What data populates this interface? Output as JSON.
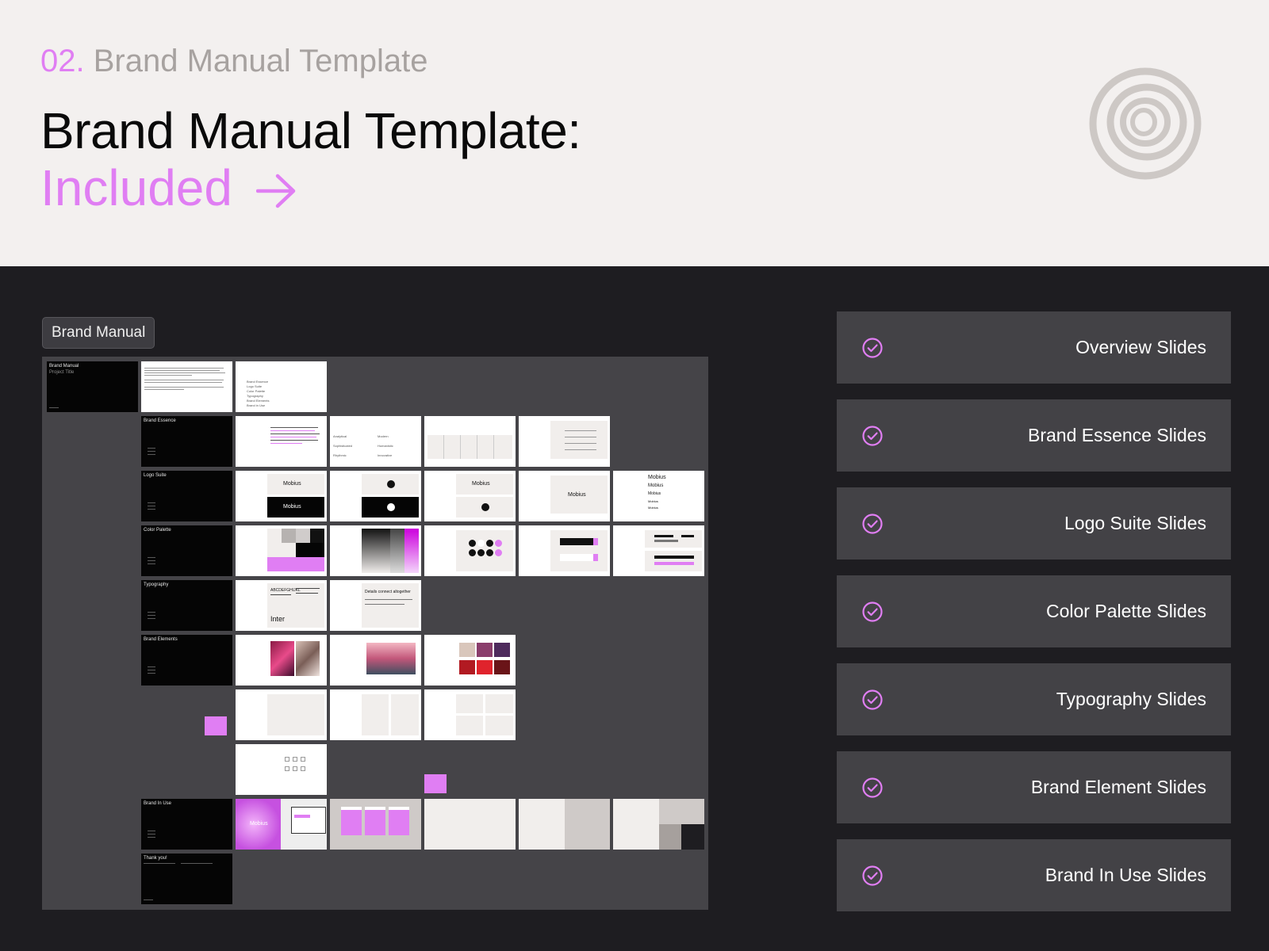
{
  "header": {
    "number": "02.",
    "eyebrow": "Brand Manual Template",
    "title": "Brand Manual Template:",
    "accent": "Included",
    "accent_color": "#e07ef3",
    "logo_icon": "concentric-rings-icon"
  },
  "board": {
    "tag": "Brand Manual",
    "sections": [
      {
        "title": "Brand Manual",
        "subtitle": "Project Title"
      },
      {
        "title": "Brand Essence"
      },
      {
        "title": "Logo Suite"
      },
      {
        "title": "Color Palette"
      },
      {
        "title": "Typography"
      },
      {
        "title": "Brand Elements"
      },
      {
        "title": "Brand In Use"
      },
      {
        "title": "Thank you!"
      }
    ],
    "toc": [
      "Brand Essence",
      "Logo Suite",
      "Color Palette",
      "Typography",
      "Brand Elements",
      "Brand in Use"
    ],
    "essence_words": [
      "Analytical",
      "Modern",
      "Sophisticated",
      "Humanistic",
      "Rhythmic",
      "Innovative"
    ],
    "logo_word": "Mobius",
    "typeface_name": "Inter",
    "type_specimen": "ABCDEFGHIJKL",
    "type_sample": "Details connect altogether"
  },
  "features": {
    "check_icon": "check-circle-icon",
    "items": [
      "Overview Slides",
      "Brand Essence Slides",
      "Logo Suite Slides",
      "Color Palette Slides",
      "Typography Slides",
      "Brand Element Slides",
      "Brand In Use Slides"
    ]
  }
}
